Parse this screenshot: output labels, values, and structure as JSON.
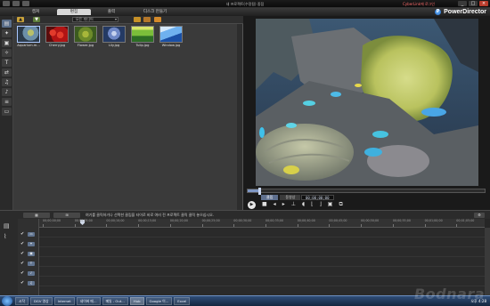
{
  "window": {
    "title": "새 프로젝트(수정됨) 중점",
    "user_link": "CyberLink에 로그인",
    "min": "_",
    "max": "□",
    "close": "×"
  },
  "tabs": [
    {
      "label": "캡쳐",
      "active": false
    },
    {
      "label": "편집",
      "active": true
    },
    {
      "label": "출력",
      "active": false
    },
    {
      "label": "디스크 만들기",
      "active": false
    }
  ],
  "brand": {
    "name": "PowerDirector",
    "logo": "P"
  },
  "left_toolbar": [
    {
      "icon": "media-room-icon"
    },
    {
      "icon": "effect-room-icon"
    },
    {
      "icon": "pip-room-icon"
    },
    {
      "icon": "particle-room-icon"
    },
    {
      "icon": "title-room-icon"
    },
    {
      "icon": "transition-room-icon"
    },
    {
      "icon": "audio-mixing-room-icon"
    },
    {
      "icon": "voice-over-room-icon"
    },
    {
      "icon": "chapter-room-icon"
    },
    {
      "icon": "subtitle-room-icon"
    }
  ],
  "library": {
    "filter": "모든 미디어",
    "items": [
      {
        "name": "Aquarium.m...",
        "colors": [
          "#2b3a4a",
          "#6c8fa8",
          "#b8c06a"
        ],
        "selected": true
      },
      {
        "name": "Cherry.jpg",
        "colors": [
          "#b11414",
          "#e23b2b",
          "#5a0d0d"
        ],
        "selected": false
      },
      {
        "name": "Flower.jpg",
        "colors": [
          "#3c5b1f",
          "#a7b63a",
          "#6d8a2a"
        ],
        "selected": false
      },
      {
        "name": "Lily.jpg",
        "colors": [
          "#243a64",
          "#6f88c6",
          "#c6d2ee"
        ],
        "selected": false
      },
      {
        "name": "Tulip.jpg",
        "colors": [
          "#2c6c24",
          "#7bbe3a",
          "#d8e66a"
        ],
        "selected": false
      },
      {
        "name": "Window.jpg",
        "colors": [
          "#1a4fa5",
          "#6fb1ef",
          "#d6e9fb"
        ],
        "selected": false
      }
    ]
  },
  "preview": {
    "modes": [
      "클립",
      "동영상"
    ],
    "active_mode": "클립",
    "timecode": "00;00;00;00",
    "progress": 0.05
  },
  "timeline_toolbar": {
    "message": "여기를 클릭하거나 선택한 클립을 타이로 바로 여러 전 프로젝트 클릭 클릭 놓으십시오.",
    "buttons": [
      "▦",
      "⊞",
      "✂",
      "⚙"
    ]
  },
  "timeline": {
    "ticks": [
      "00;00;00;00",
      "00;00;05;00",
      "00;00;10;00",
      "00;00;15;00",
      "00;00;20;00",
      "00;00;25;00",
      "00;00;30;00",
      "00;00;35;00",
      "00;00;40;00",
      "00;00;45;00",
      "00;00;50;00",
      "00;00;55;00",
      "00;01;00;00",
      "00;01;05;00"
    ],
    "tracks": [
      "video-1",
      "effect-1",
      "pip-1",
      "title-1",
      "voice-1",
      "music-1",
      "chapter-1"
    ]
  },
  "taskbar": {
    "items": [
      "시작",
      "DGV 영상",
      "Internet",
      "네이버 메...",
      "메일 - Out...",
      "Hub",
      "Google 이...",
      "Excel"
    ],
    "tray": "오후 4:28"
  },
  "watermark": "Bodnara"
}
